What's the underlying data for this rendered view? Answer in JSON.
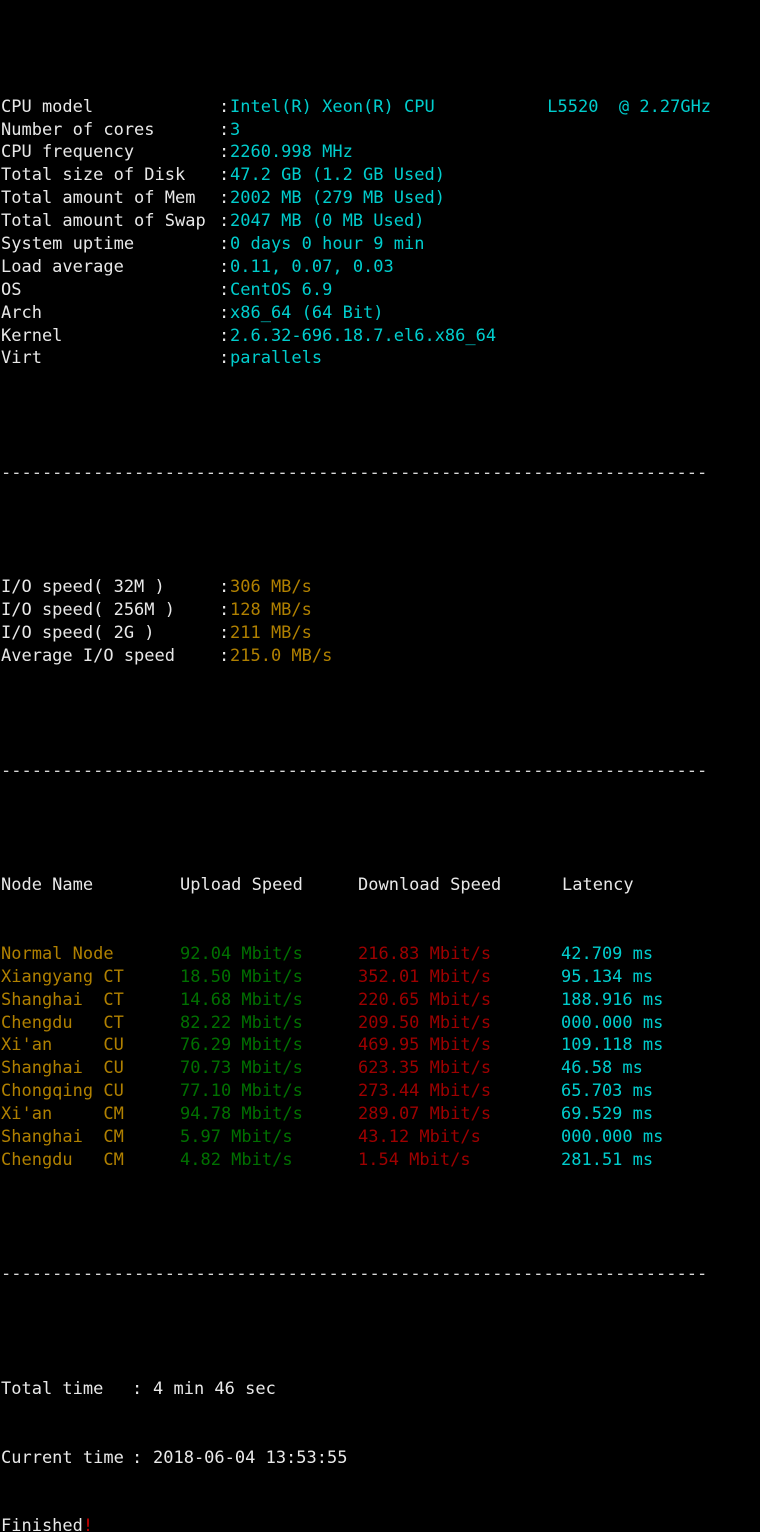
{
  "terminal": {
    "background": "#000000",
    "palette": {
      "white": "#e8e8e8",
      "cyan": "#00cdcd",
      "yellow": "#b08000",
      "green": "#007000",
      "red": "#9e0000"
    },
    "separator": "---------------------------------------------------------------------"
  },
  "system_info": [
    {
      "label": "CPU model",
      "value": "Intel(R) Xeon(R) CPU           L5520  @ 2.27GHz"
    },
    {
      "label": "Number of cores",
      "value": "3"
    },
    {
      "label": "CPU frequency",
      "value": "2260.998 MHz"
    },
    {
      "label": "Total size of Disk",
      "value": "47.2 GB (1.2 GB Used)"
    },
    {
      "label": "Total amount of Mem",
      "value": "2002 MB (279 MB Used)"
    },
    {
      "label": "Total amount of Swap",
      "value": "2047 MB (0 MB Used)"
    },
    {
      "label": "System uptime",
      "value": "0 days 0 hour 9 min"
    },
    {
      "label": "Load average",
      "value": "0.11, 0.07, 0.03"
    },
    {
      "label": "OS",
      "value": "CentOS 6.9"
    },
    {
      "label": "Arch",
      "value": "x86_64 (64 Bit)"
    },
    {
      "label": "Kernel",
      "value": "2.6.32-696.18.7.el6.x86_64"
    },
    {
      "label": "Virt",
      "value": "parallels"
    }
  ],
  "io_speed": [
    {
      "label": "I/O speed( 32M )",
      "value": "306 MB/s"
    },
    {
      "label": "I/O speed( 256M )",
      "value": "128 MB/s"
    },
    {
      "label": "I/O speed( 2G )",
      "value": "211 MB/s"
    },
    {
      "label": "Average I/O speed",
      "value": "215.0 MB/s"
    }
  ],
  "speedtest": {
    "headers": {
      "node": "Node Name",
      "upload": "Upload Speed",
      "download": "Download Speed",
      "latency": "Latency"
    },
    "rows": [
      {
        "node": "Normal Node",
        "upload": "92.04 Mbit/s",
        "download": "216.83 Mbit/s",
        "latency": "42.709 ms"
      },
      {
        "node": "Xiangyang CT",
        "upload": "18.50 Mbit/s",
        "download": "352.01 Mbit/s",
        "latency": "95.134 ms"
      },
      {
        "node": "Shanghai  CT",
        "upload": "14.68 Mbit/s",
        "download": "220.65 Mbit/s",
        "latency": "188.916 ms"
      },
      {
        "node": "Chengdu   CT",
        "upload": "82.22 Mbit/s",
        "download": "209.50 Mbit/s",
        "latency": "000.000 ms"
      },
      {
        "node": "Xi'an     CU",
        "upload": "76.29 Mbit/s",
        "download": "469.95 Mbit/s",
        "latency": "109.118 ms"
      },
      {
        "node": "Shanghai  CU",
        "upload": "70.73 Mbit/s",
        "download": "623.35 Mbit/s",
        "latency": "46.58 ms"
      },
      {
        "node": "Chongqing CU",
        "upload": "77.10 Mbit/s",
        "download": "273.44 Mbit/s",
        "latency": "65.703 ms"
      },
      {
        "node": "Xi'an     CM",
        "upload": "94.78 Mbit/s",
        "download": "289.07 Mbit/s",
        "latency": "69.529 ms"
      },
      {
        "node": "Shanghai  CM",
        "upload": "5.97 Mbit/s",
        "download": "43.12 Mbit/s",
        "latency": "000.000 ms"
      },
      {
        "node": "Chengdu   CM",
        "upload": "4.82 Mbit/s",
        "download": "1.54 Mbit/s",
        "latency": "281.51 ms"
      }
    ]
  },
  "footer": {
    "total_time_label": "Total time",
    "total_time_value": "4 min 46 sec",
    "current_time_label": "Current time",
    "current_time_value": "2018-06-04 13:53:55",
    "finished_text": "Finished",
    "finished_bang": "!"
  }
}
